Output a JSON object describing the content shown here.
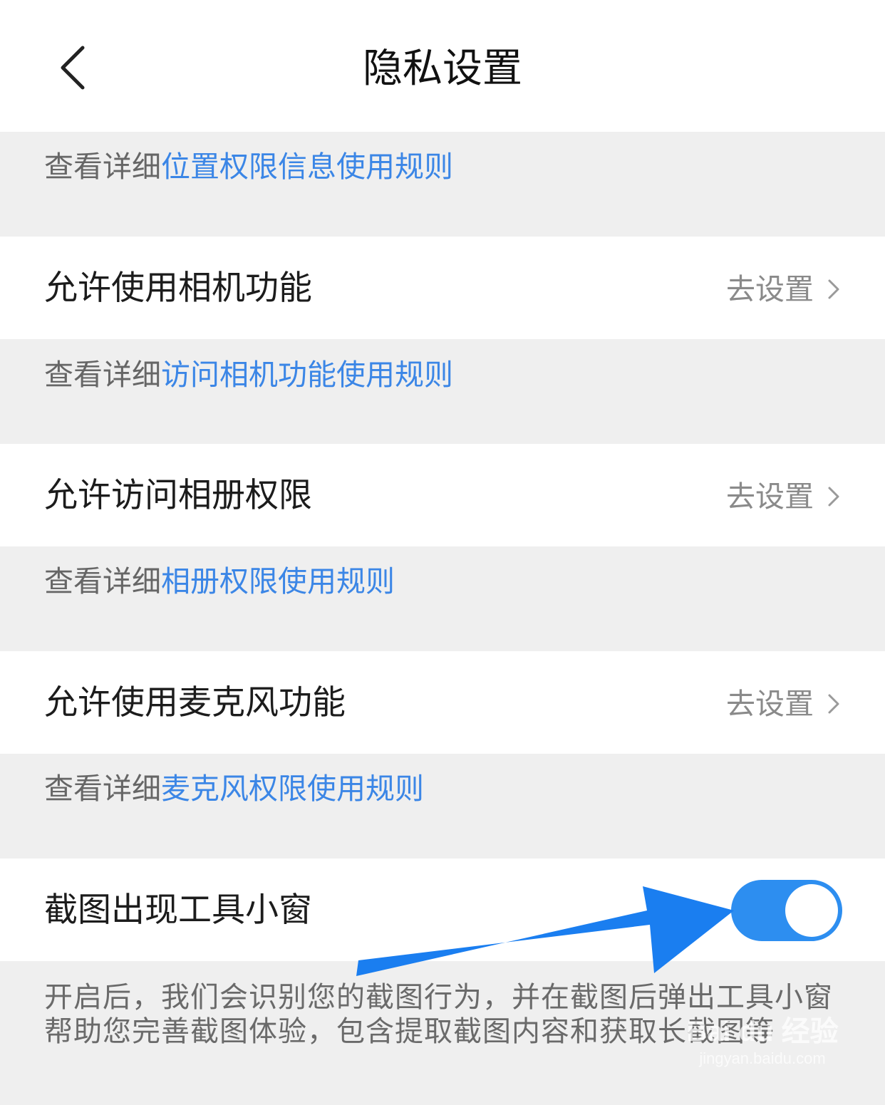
{
  "header": {
    "title": "隐私设置",
    "back_icon": "chevron-left-icon"
  },
  "location_note": {
    "prefix": "查看详细",
    "link": "位置权限信息使用规则"
  },
  "settings": [
    {
      "label": "允许使用相机功能",
      "action": "去设置",
      "note_prefix": "查看详细",
      "note_link": "访问相机功能使用规则"
    },
    {
      "label": "允许访问相册权限",
      "action": "去设置",
      "note_prefix": "查看详细",
      "note_link": "相册权限使用规则"
    },
    {
      "label": "允许使用麦克风功能",
      "action": "去设置",
      "note_prefix": "查看详细",
      "note_link": "麦克风权限使用规则"
    }
  ],
  "screenshot_toolbox": {
    "label": "截图出现工具小窗",
    "enabled": true,
    "description": "开启后，我们会识别您的截图行为，并在截图后弹出工具小窗帮助您完善截图体验，包含提取截图内容和获取长截图等"
  },
  "annotation": {
    "arrow_color": "#1a7ef0"
  },
  "watermark": {
    "logo": "Bai du 经验",
    "url": "jingyan.baidu.com"
  },
  "colors": {
    "link": "#3b86e6",
    "toggle_on": "#2d8ef0",
    "background": "#efefef"
  }
}
